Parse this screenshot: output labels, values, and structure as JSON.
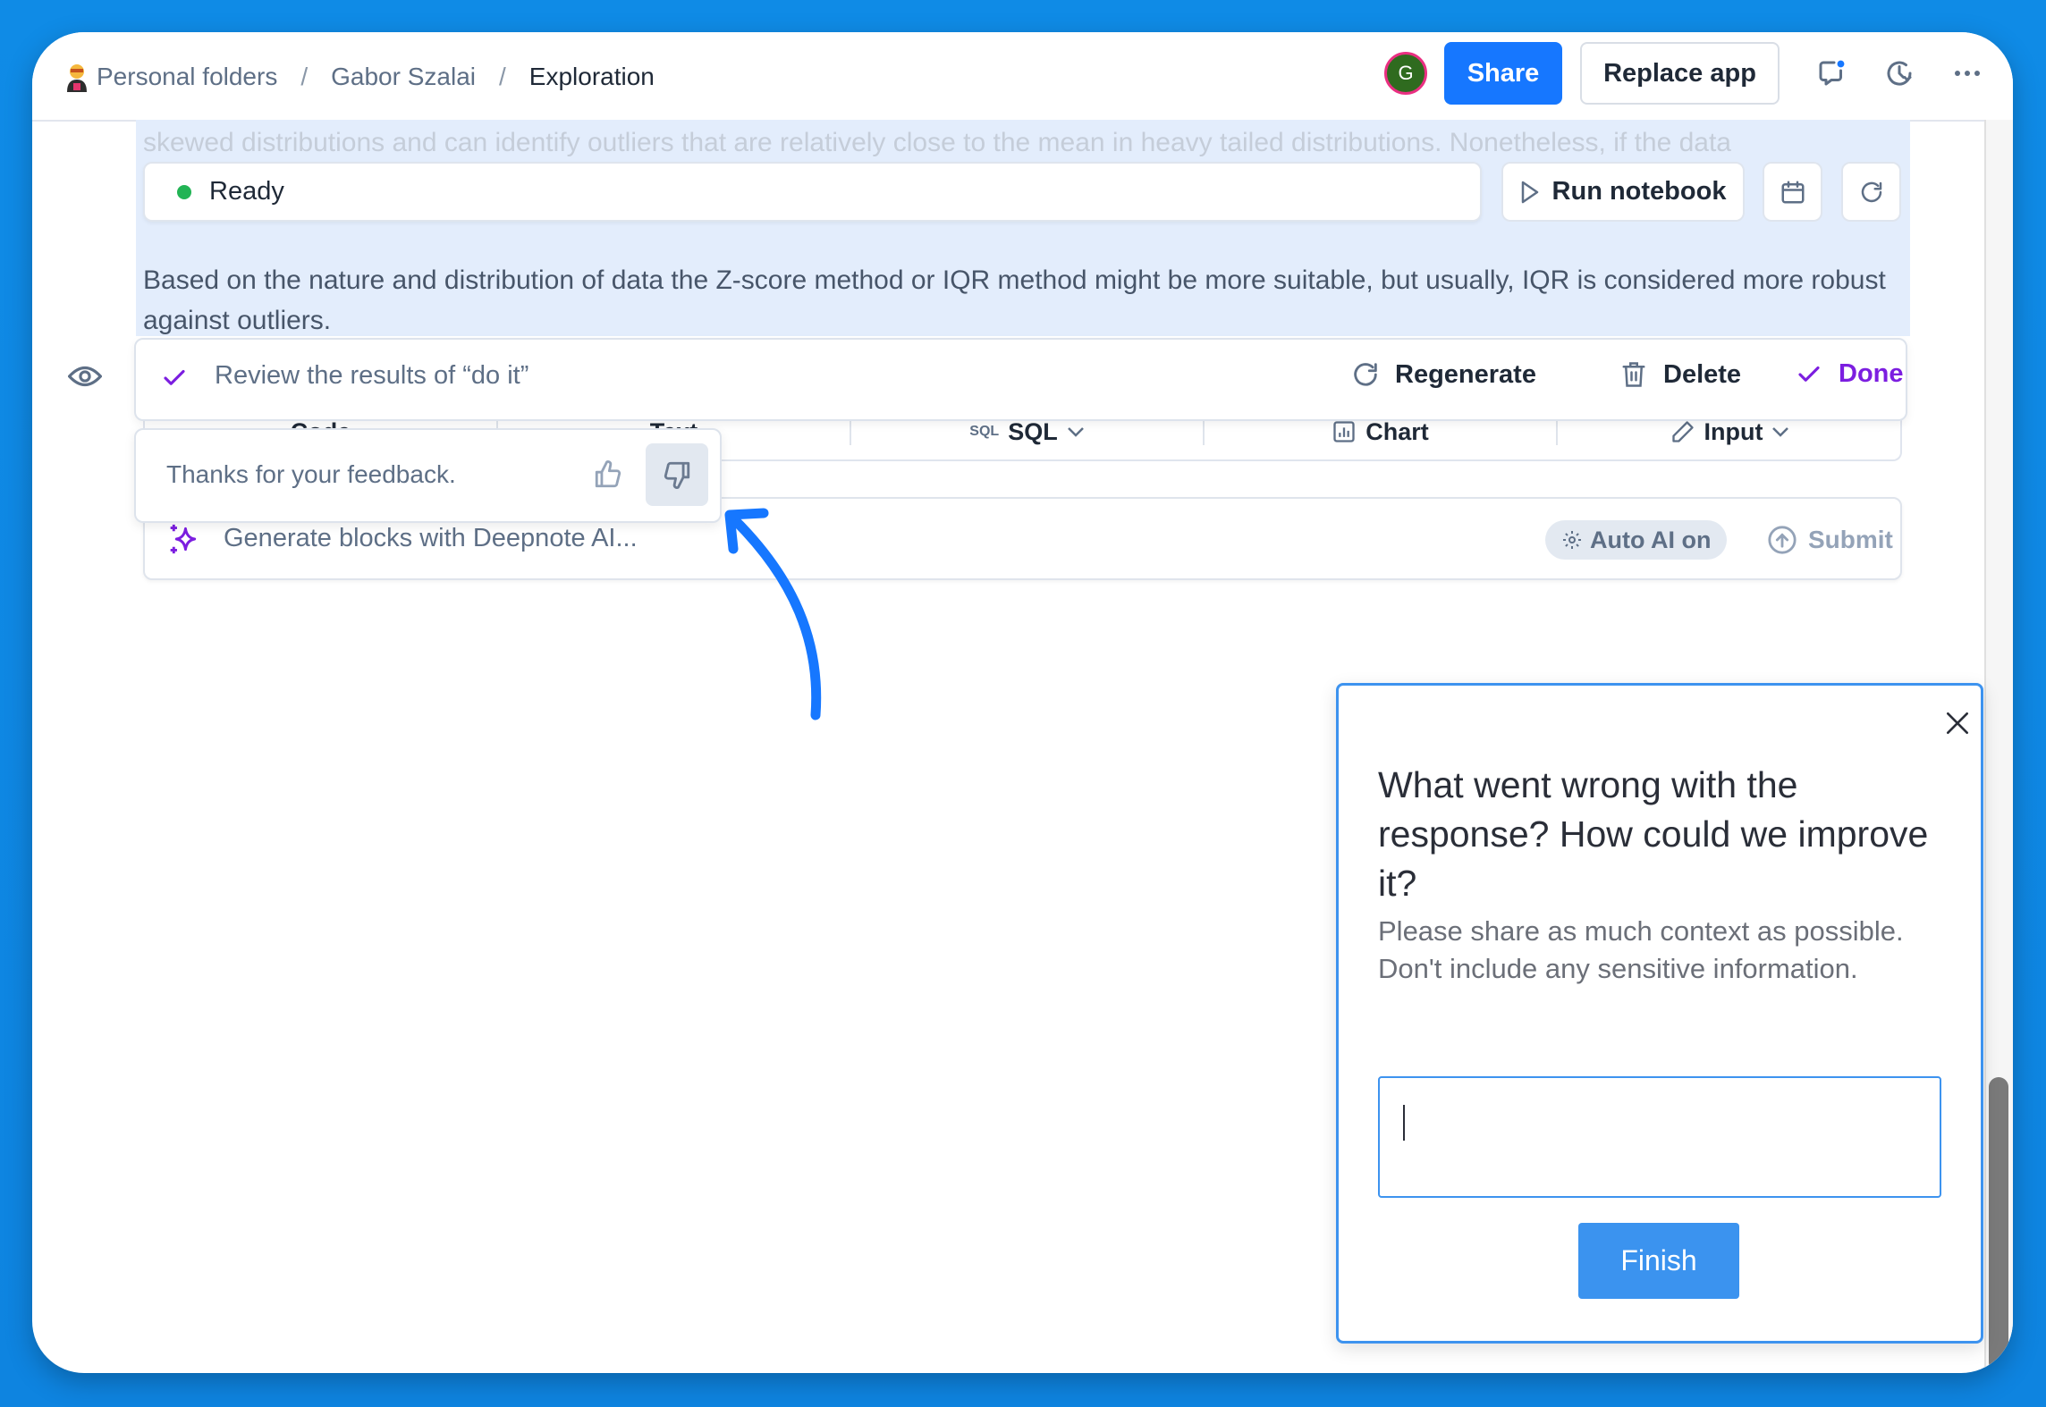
{
  "breadcrumb": {
    "items": [
      "Personal folders",
      "Gabor Szalai",
      "Exploration"
    ],
    "separator": "/",
    "emoji_icon": "person-with-hardhat"
  },
  "header": {
    "avatar_initial": "G",
    "share_label": "Share",
    "replace_app_label": "Replace app",
    "icons": [
      "comment-icon",
      "history-icon",
      "more-icon"
    ]
  },
  "notebook": {
    "faded_text": "skewed distributions and can identify outliers that are relatively close to the mean in heavy tailed distributions. Nonetheless, if the data",
    "status": "Ready",
    "run_notebook_label": "Run notebook",
    "body_text": "Based on the nature and distribution of data the Z-score method or IQR method might be more suitable, but usually, IQR is considered more robust against outliers."
  },
  "review": {
    "label": "Review the results of “do it”",
    "regenerate_label": "Regenerate",
    "delete_label": "Delete",
    "done_label": "Done"
  },
  "block_types": {
    "items": [
      "Code",
      "Text",
      "SQL",
      "Chart",
      "Input"
    ]
  },
  "ai_input": {
    "placeholder": "Generate blocks with Deepnote AI...",
    "auto_ai_label": "Auto AI on",
    "submit_label": "Submit"
  },
  "feedback_popup": {
    "text": "Thanks for your feedback."
  },
  "dialog": {
    "title": "What went wrong with the response? How could we improve it?",
    "description": "Please share as much context as possible. Don't include any sensitive information.",
    "textarea_value": "",
    "finish_label": "Finish"
  },
  "colors": {
    "accent_blue": "#1677ff",
    "done_purple": "#7c1ee0",
    "ready_green": "#22b455",
    "dialog_border": "#3d93ef",
    "annotation_arrow": "#1677ff"
  }
}
